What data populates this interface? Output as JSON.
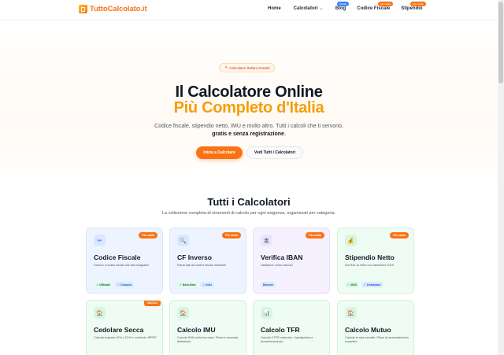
{
  "nav": {
    "logo_text": "TuttoCalcolato.it",
    "links": {
      "home": "Home",
      "calcolatori": "Calcolatori",
      "blog": "Blog",
      "codice_fiscale": "Codice Fiscale",
      "stipendio": "Stipendio"
    },
    "badges": {
      "blog": "nuovo",
      "codice_fiscale": "più usato",
      "stipendio": "più usato"
    }
  },
  "hero": {
    "pill": "Calcolatori Italiani Gratuiti",
    "title_line1": "Il Calcolatore Online",
    "title_line2": "Più Completo d'Italia",
    "subtitle_line1": "Codice fiscale, stipendio netto, IMU e molto altro. Tutti i calcoli che ti servono,",
    "subtitle_bold": "gratis e senza registrazione",
    "subtitle_end": ".",
    "cta_primary": "Inizia a Calcolare",
    "cta_secondary": "Vedi Tutti i Calcolatori"
  },
  "section": {
    "title": "Tutti i Calcolatori",
    "subtitle": "La collezione completa di strumenti di calcolo per ogni esigenza, organizzati per categoria."
  },
  "cards": [
    {
      "title": "Codice Fiscale",
      "desc": "Genera il codice fiscale dai dati anagrafici",
      "badge": "Più usato",
      "icon": "pencil-icon",
      "glyph": "✏",
      "tags": [
        "✓ Ufficiale",
        "✓ Comune"
      ]
    },
    {
      "title": "CF Inverso",
      "desc": "Estrai dati da codice fiscale esistente",
      "badge": "Più usato",
      "icon": "magnifier-icon",
      "glyph": "🔍",
      "tags": [
        "✓ Best-New",
        "✓ Intel"
      ]
    },
    {
      "title": "Verifica IBAN",
      "desc": "Validatore conto bancari",
      "badge": "Più usato",
      "icon": "bank-icon",
      "glyph": "🏦",
      "tags": [
        "Banche"
      ]
    },
    {
      "title": "Stipendio Netto",
      "desc": "Dal RAL al netto con detrazioni 2025",
      "badge": "Più usato",
      "icon": "money-icon",
      "glyph": "💰",
      "tags": [
        "✓ 2025",
        "✓ Detrazioni"
      ]
    },
    {
      "title": "Cedolare Secca",
      "desc": "Calcola imposta 10% o 21% e confronto IRPEF.",
      "badge": "NUOVO",
      "icon": "house-icon",
      "glyph": "🏠",
      "tags": []
    },
    {
      "title": "Calcolo IMU",
      "desc": "Calcola l'IMU sulla tua casa. Prima e seconda abitazione.",
      "badge": "",
      "icon": "house-icon",
      "glyph": "🏠",
      "tags": []
    },
    {
      "title": "Calcolo TFR",
      "desc": "Calcola il TFR maturato. Liquidazione e accantonamento.",
      "badge": "",
      "icon": "chart-icon",
      "glyph": "📊",
      "tags": []
    },
    {
      "title": "Calcolo Mutuo",
      "desc": "Calcola la rata mensile. Piano di ammortamento completo.",
      "badge": "",
      "icon": "house-icon",
      "glyph": "🏠",
      "tags": []
    }
  ],
  "colors": {
    "brand": "#f97316",
    "accent": "#f59e0b"
  }
}
